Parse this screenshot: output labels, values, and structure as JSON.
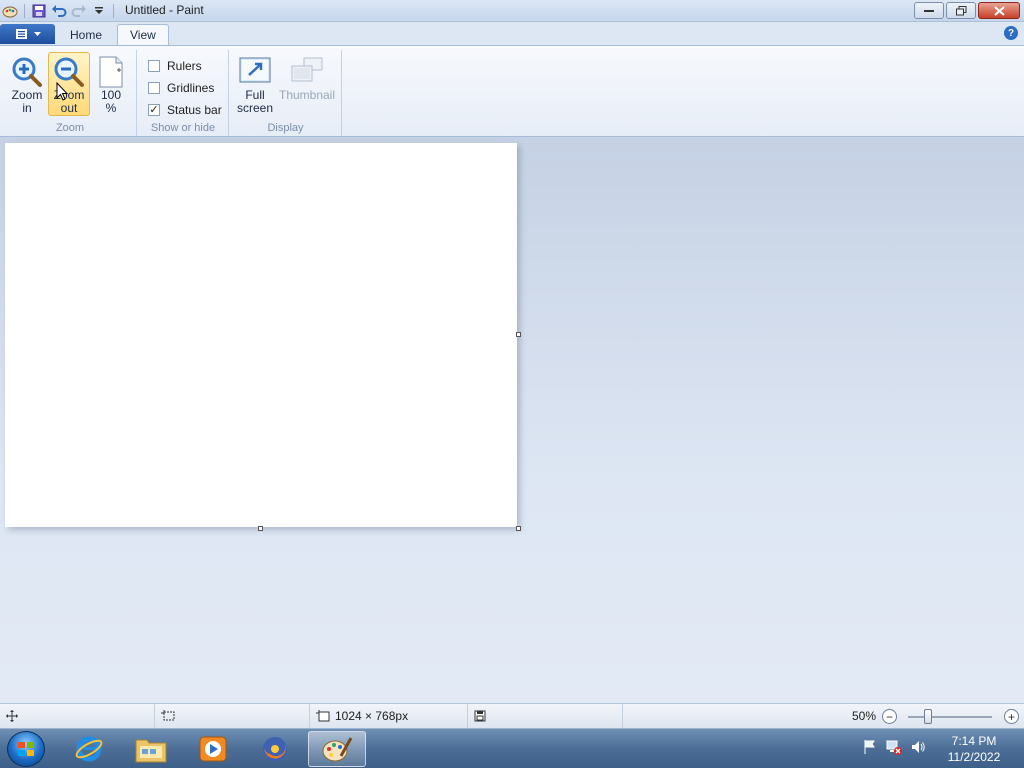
{
  "window": {
    "title": "Untitled - Paint"
  },
  "tabs": {
    "home": "Home",
    "view": "View"
  },
  "ribbon": {
    "zoom_group": {
      "label": "Zoom",
      "zoom_in": "Zoom in",
      "zoom_out": "Zoom out",
      "hundred": "100 %"
    },
    "show_hide_group": {
      "label": "Show or hide",
      "rulers": {
        "label": "Rulers",
        "checked": false
      },
      "gridlines": {
        "label": "Gridlines",
        "checked": false
      },
      "status_bar": {
        "label": "Status bar",
        "checked": true
      }
    },
    "display_group": {
      "label": "Display",
      "full_screen": "Full screen",
      "thumbnail": "Thumbnail"
    }
  },
  "statusbar": {
    "image_size": "1024 × 768px",
    "zoom_level": "50%"
  },
  "taskbar": {
    "apps": [
      "internet-explorer",
      "file-explorer",
      "media-player",
      "firefox",
      "paint"
    ],
    "active_app": "paint",
    "time": "7:14 PM",
    "date": "11/2/2022"
  },
  "colors": {
    "accent": "#1d4f9c",
    "hot_button": "#ffd978"
  }
}
